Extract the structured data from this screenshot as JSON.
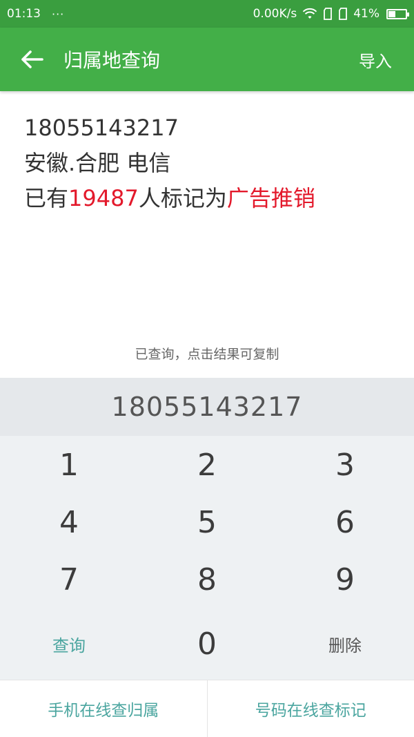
{
  "status_bar": {
    "time": "01:13",
    "dots": "···",
    "speed": "0.00K/s",
    "battery": "41%",
    "battery_level": 0.41
  },
  "toolbar": {
    "title": "归属地查询",
    "import_label": "导入"
  },
  "result": {
    "number": "18055143217",
    "location": "安徽.合肥 电信",
    "mark_prefix": "已有",
    "mark_count": "19487",
    "mark_middle": "人标记为",
    "mark_tag": "广告推销",
    "highlight_color": "#e3192b"
  },
  "hint": "已查询，点击结果可复制",
  "display": {
    "number": "18055143217"
  },
  "keypad": {
    "keys": [
      "1",
      "2",
      "3",
      "4",
      "5",
      "6",
      "7",
      "8",
      "9"
    ],
    "query_label": "查询",
    "zero": "0",
    "delete_label": "删除"
  },
  "bottom_bar": {
    "left_label": "手机在线查归属",
    "right_label": "号码在线查标记"
  },
  "colors": {
    "status_bar": "#3a9e3f",
    "toolbar": "#43af48",
    "accent_teal": "#4aa59f"
  }
}
